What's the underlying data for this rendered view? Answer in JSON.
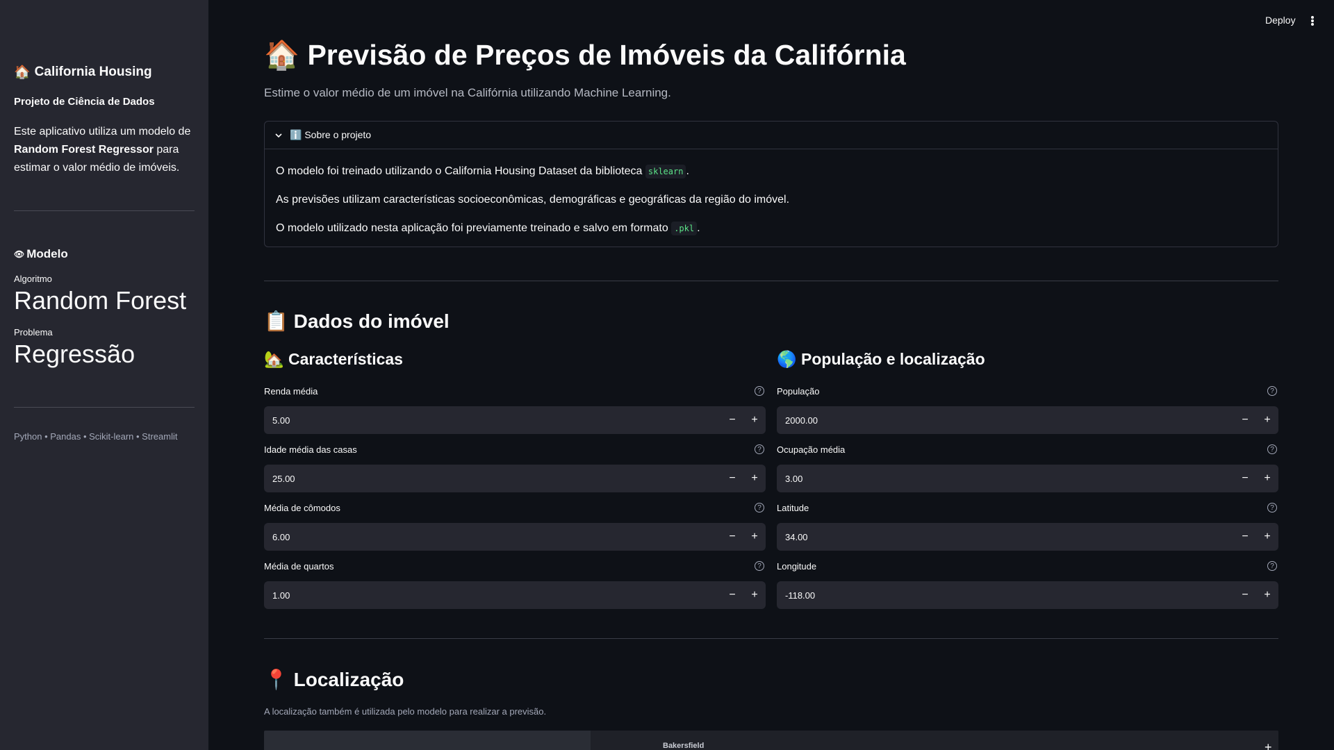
{
  "sidebar": {
    "title": "California Housing",
    "title_icon": "house-emoji",
    "subtitle": "Projeto de Ciência de Dados",
    "desc_part1": "Este aplicativo utiliza um modelo de ",
    "desc_bold": "Random Forest Regressor",
    "desc_part2": " para estimar o valor médio de imóveis.",
    "model_heading": "Modelo",
    "metrics": [
      {
        "label": "Algoritmo",
        "value": "Random Forest"
      },
      {
        "label": "Problema",
        "value": "Regressão"
      }
    ],
    "footer": "Python • Pandas • Scikit-learn • Streamlit"
  },
  "header": {
    "deploy_label": "Deploy"
  },
  "main": {
    "title": "🏠 Previsão de Preços de Imóveis da Califórnia",
    "subtitle": "Estime o valor médio de um imóvel na Califórnia utilizando Machine Learning.",
    "expander": {
      "label": "ℹ️ Sobre o projeto",
      "p1_text": "O modelo foi treinado utilizando o California Housing Dataset da biblioteca ",
      "p1_code": "sklearn",
      "p1_end": ".",
      "p2_text": "As previsões utilizam características socioeconômicas, demográficas e geográficas da região do imóvel.",
      "p3_text": "O modelo utilizado nesta aplicação foi previamente treinado e salvo em formato ",
      "p3_code": ".pkl",
      "p3_end": "."
    },
    "section_data_title": "📋 Dados do imóvel",
    "col_left_title": "🏡 Características",
    "col_right_title": "🌎 População e localização",
    "fields_left": [
      {
        "label": "Renda média",
        "value": "5.00"
      },
      {
        "label": "Idade média das casas",
        "value": "25.00"
      },
      {
        "label": "Média de cômodos",
        "value": "6.00"
      },
      {
        "label": "Média de quartos",
        "value": "1.00"
      }
    ],
    "fields_right": [
      {
        "label": "População",
        "value": "2000.00"
      },
      {
        "label": "Ocupação média",
        "value": "3.00"
      },
      {
        "label": "Latitude",
        "value": "34.00"
      },
      {
        "label": "Longitude",
        "value": "-118.00"
      }
    ],
    "section_loc_title": "📍 Localização",
    "loc_caption": "A localização também é utilizada pelo modelo para realizar a previsão.",
    "map_city": "Bakersfield",
    "map_zoom_label": "+"
  },
  "colors": {
    "background": "#0e1117",
    "sidebar": "#262730",
    "input": "#262730",
    "code_text": "#5ce488"
  }
}
